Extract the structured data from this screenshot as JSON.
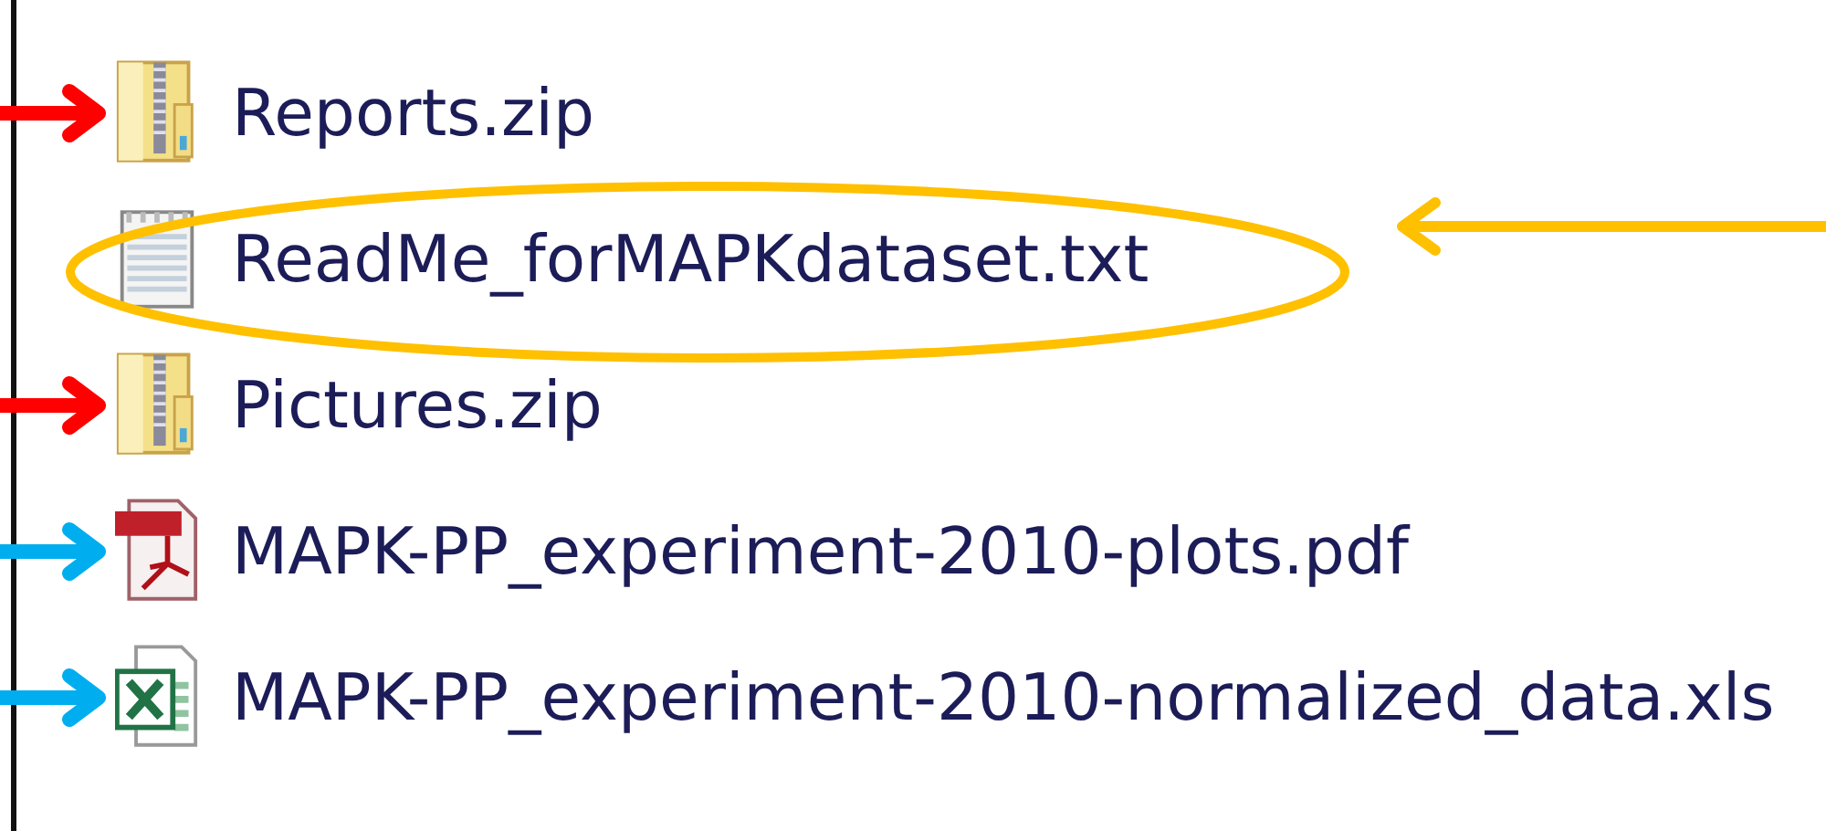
{
  "files": [
    {
      "name": "Reports.zip",
      "kind": "zip",
      "annotation": {
        "kind": "arrow",
        "color": "#ff0000"
      }
    },
    {
      "name": "ReadMe_forMAPKdataset.txt",
      "kind": "text",
      "annotation": {
        "kind": "circle",
        "color": "#ffc000"
      }
    },
    {
      "name": "Pictures.zip",
      "kind": "zip",
      "annotation": {
        "kind": "arrow",
        "color": "#ff0000"
      }
    },
    {
      "name": "MAPK-PP_experiment-2010-plots.pdf",
      "kind": "pdf",
      "annotation": {
        "kind": "arrow",
        "color": "#00aeef"
      }
    },
    {
      "name": "MAPK-PP_experiment-2010-normalized_data.xls",
      "kind": "excel",
      "annotation": {
        "kind": "arrow",
        "color": "#00aeef"
      }
    }
  ]
}
